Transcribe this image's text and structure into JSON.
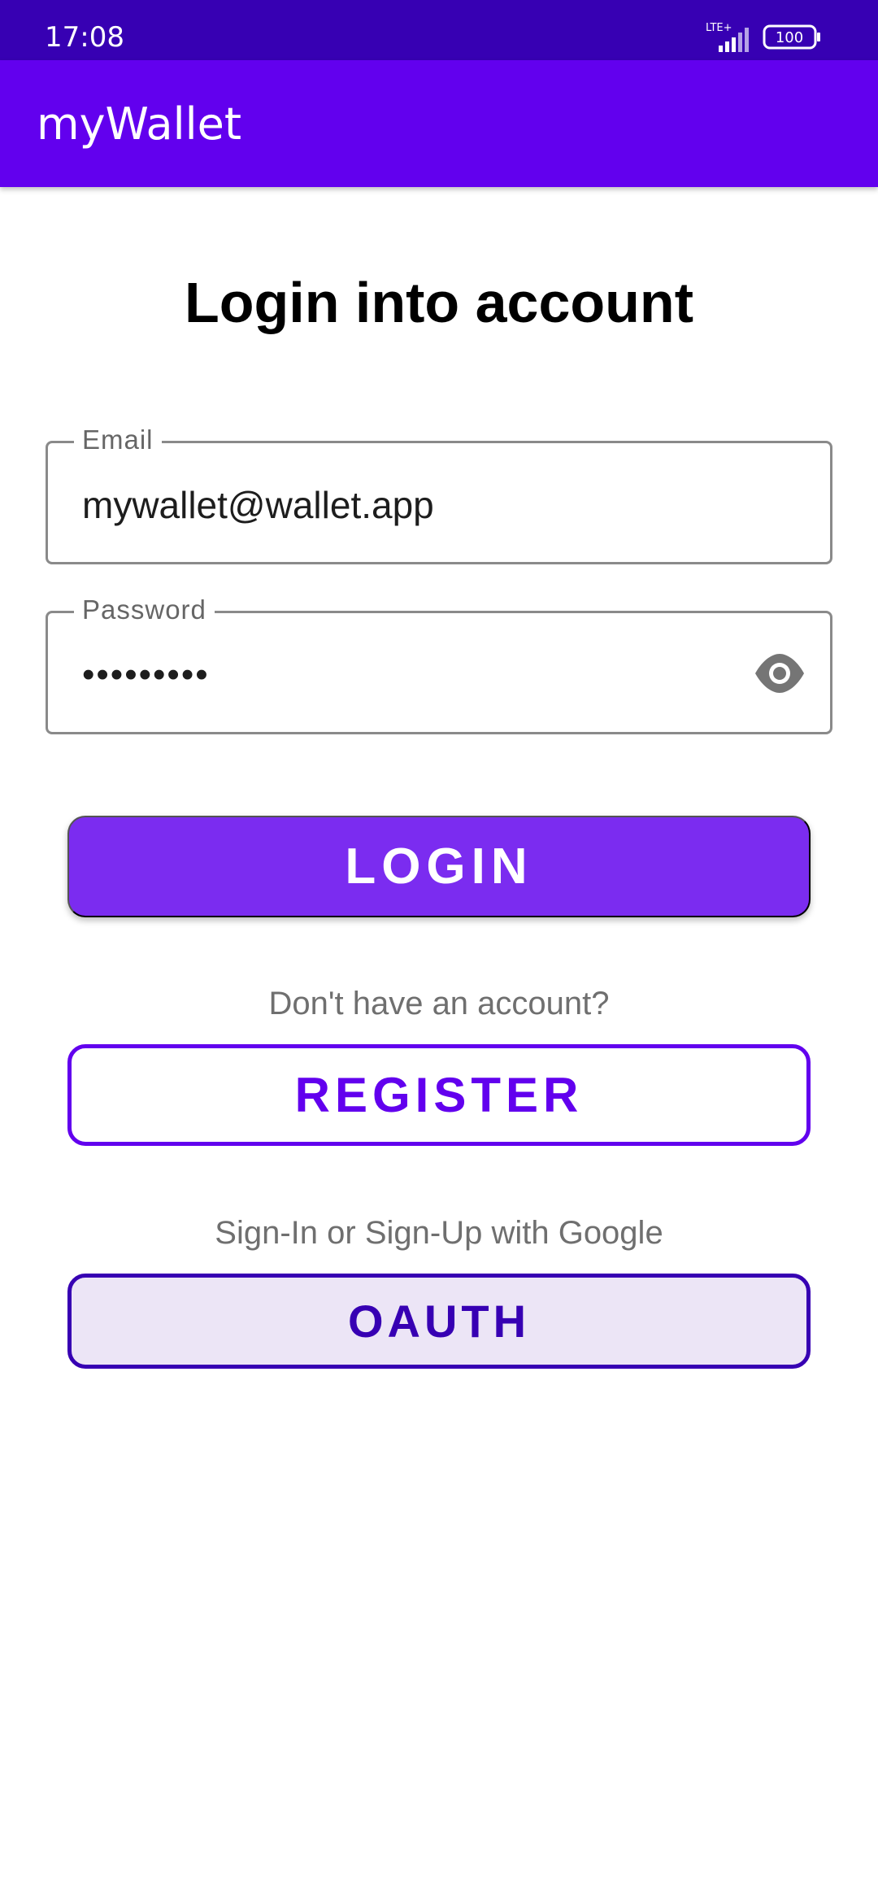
{
  "status_bar": {
    "time": "17:08",
    "network": "LTE+",
    "battery": "100",
    "icons": [
      "lte-icon",
      "signal-icon",
      "battery-icon"
    ]
  },
  "app_bar": {
    "title": "myWallet"
  },
  "page": {
    "title": "Login into account"
  },
  "form": {
    "email": {
      "label": "Email",
      "value": "mywallet@wallet.app"
    },
    "password": {
      "label": "Password",
      "masked_value": "•••••••••",
      "toggle_icon": "eye-icon"
    }
  },
  "actions": {
    "login_label": "LOGIN",
    "register_hint": "Don't have an account?",
    "register_label": "REGISTER",
    "google_hint": "Sign-In or Sign-Up with Google",
    "oauth_label": "OAUTH"
  },
  "colors": {
    "status_bar": "#3700B3",
    "app_bar": "#6200EE",
    "login_button": "#7B2CF0",
    "register_border": "#6200EE",
    "oauth_border": "#3700B3",
    "oauth_fill": "#ECE5F6"
  }
}
